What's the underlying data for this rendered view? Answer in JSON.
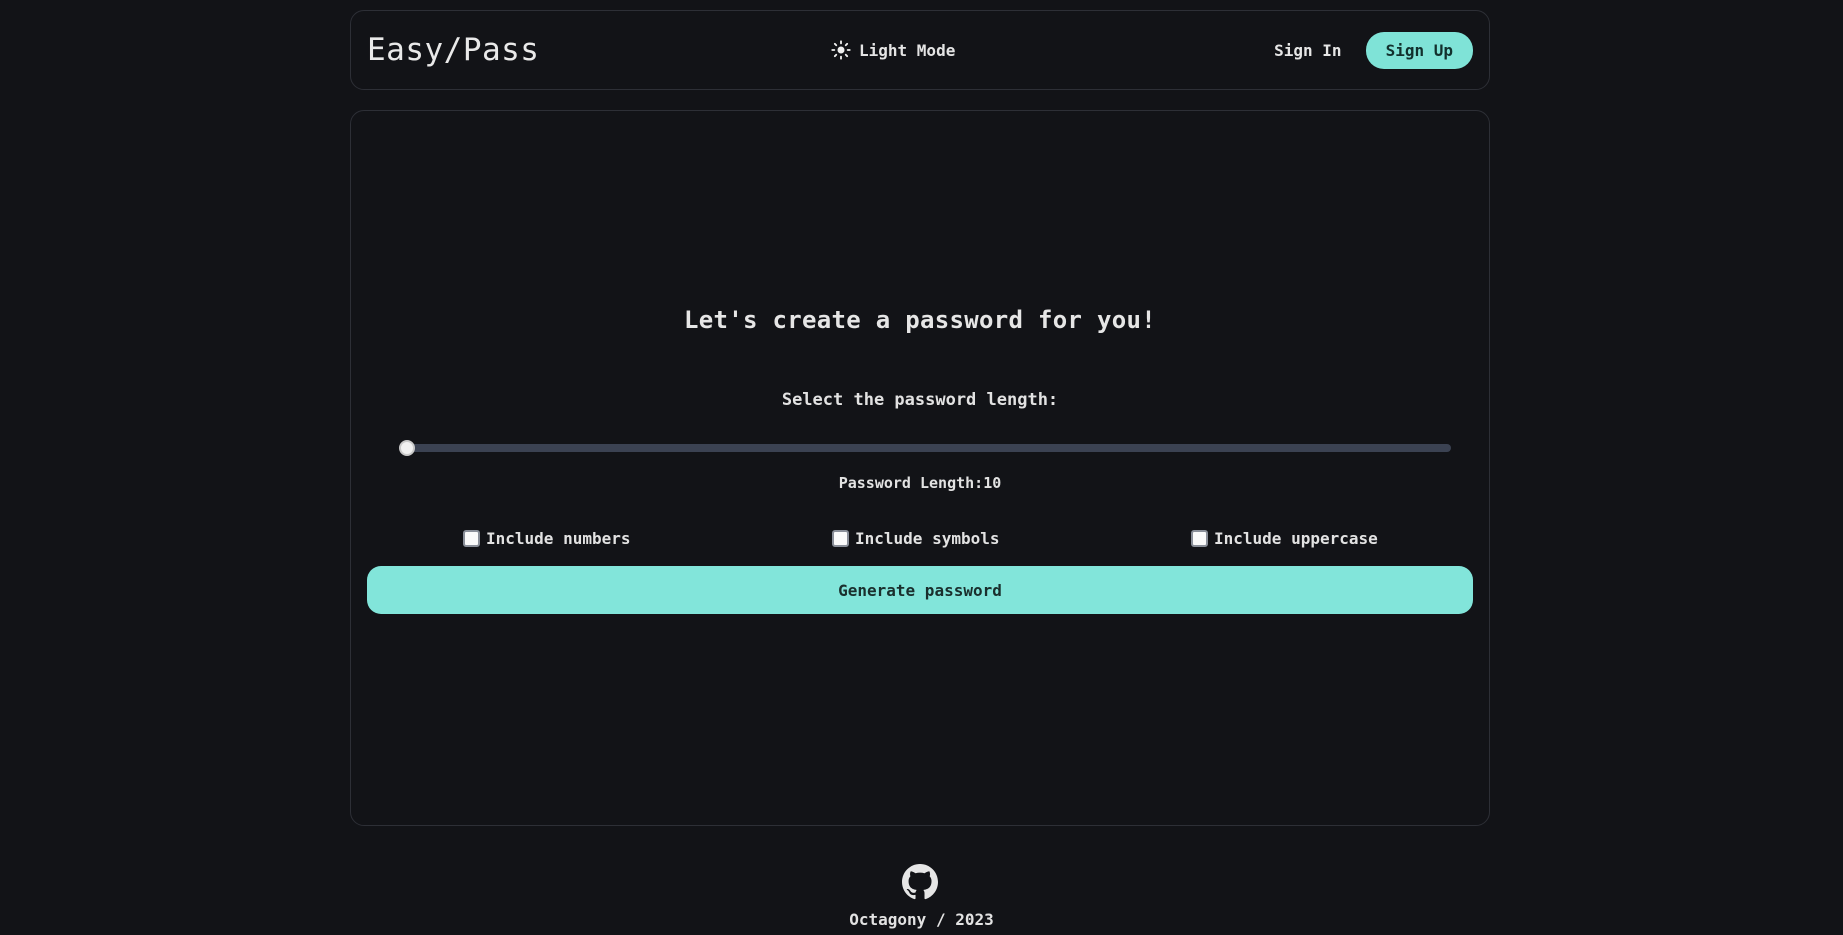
{
  "header": {
    "brand": "Easy/Pass",
    "mode_toggle": "Light Mode",
    "mode_icon": "sun-icon",
    "sign_in": "Sign In",
    "sign_up": "Sign Up"
  },
  "main": {
    "heading": "Let's create a password for you!",
    "length_prompt": "Select the password length:",
    "length_readout": "Password Length:10",
    "slider_value": 10,
    "options": {
      "numbers": "Include numbers",
      "symbols": "Include symbols",
      "uppercase": "Include uppercase"
    },
    "generate": "Generate password"
  },
  "footer": {
    "icon": "github-icon",
    "text": "Octagony / 2023"
  },
  "colors": {
    "background": "#121317",
    "accent": "#7fe3d7",
    "track": "#3b4252"
  }
}
